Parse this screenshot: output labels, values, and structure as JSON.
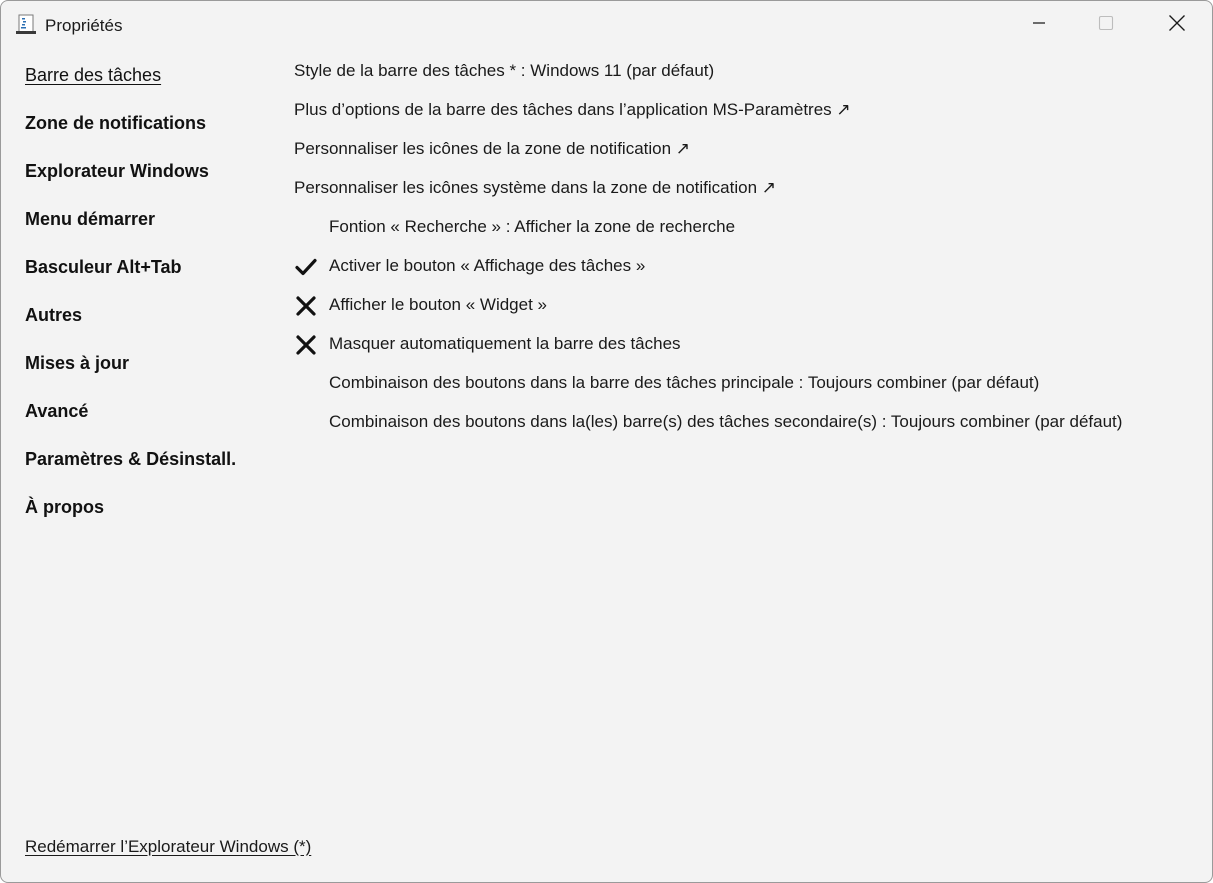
{
  "window": {
    "title": "Propriétés"
  },
  "sidebar": {
    "items": [
      {
        "label": "Barre des tâches"
      },
      {
        "label": "Zone de notifications"
      },
      {
        "label": "Explorateur Windows"
      },
      {
        "label": "Menu démarrer"
      },
      {
        "label": "Basculeur Alt+Tab"
      },
      {
        "label": "Autres"
      },
      {
        "label": "Mises à jour"
      },
      {
        "label": "Avancé"
      },
      {
        "label": "Paramètres & Désinstall."
      },
      {
        "label": "À propos"
      }
    ],
    "active_item": "Barre des tâches"
  },
  "settings": [
    {
      "label": "Style de la barre des tâches * : Windows 11 (par défaut)",
      "state": "none"
    },
    {
      "label": "Plus d’options de la barre des tâches dans l’application MS-Paramètres ↗",
      "state": "none"
    },
    {
      "label": "Personnaliser les icônes de la zone de notification ↗",
      "state": "none"
    },
    {
      "label": "Personnaliser les icônes système dans la zone de notification ↗",
      "state": "none"
    },
    {
      "label": "Fontion « Recherche » : Afficher la zone de recherche",
      "state": "blank"
    },
    {
      "label": "Activer le bouton « Affichage des tâches »",
      "state": "checked"
    },
    {
      "label": "Afficher le bouton « Widget »",
      "state": "unchecked"
    },
    {
      "label": "Masquer automatiquement la barre des tâches",
      "state": "unchecked"
    },
    {
      "label": "Combinaison des boutons dans la barre des tâches principale : Toujours combiner (par défaut)",
      "state": "blank"
    },
    {
      "label": "Combinaison des boutons dans la(les) barre(s) des tâches secondaire(s) : Toujours combiner (par défaut)",
      "state": "blank"
    }
  ],
  "footer": {
    "restart_link": "Redémarrer l’Explorateur Windows (*)"
  },
  "icons": {
    "app": "app-icon",
    "minimize": "minimize-icon",
    "maximize": "maximize-icon",
    "close": "close-icon",
    "checked": "checkmark-icon",
    "unchecked": "cross-icon"
  },
  "colors": {
    "window_background": "#f3f3f3",
    "text": "#1a1a1a",
    "disabled_glyph": "#bdbdbd"
  }
}
